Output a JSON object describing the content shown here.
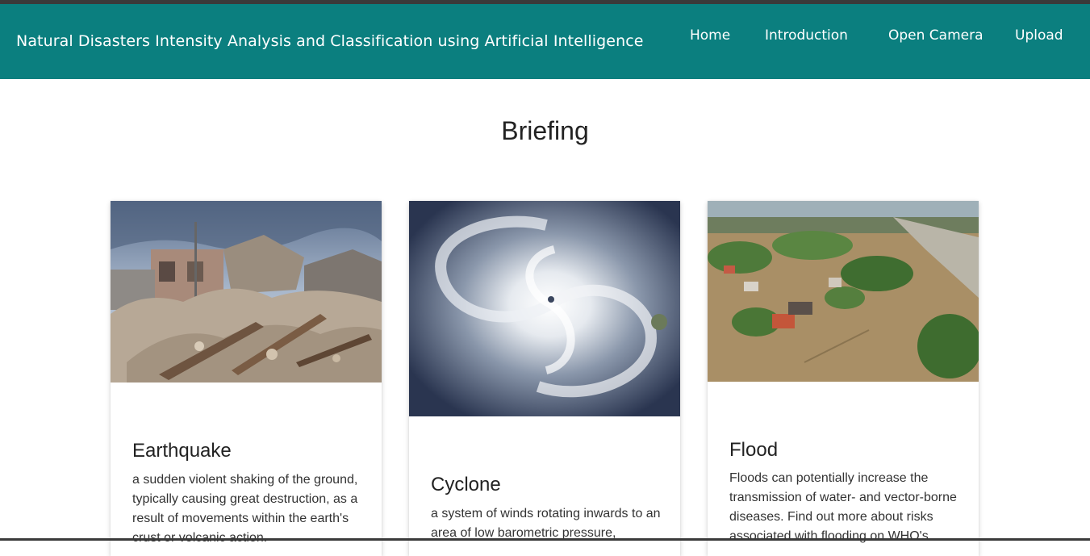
{
  "header": {
    "brand": "Natural Disasters Intensity Analysis and Classification using Artificial Intelligence",
    "nav": [
      "Home",
      "Introduction",
      "Open Camera",
      "Upload"
    ]
  },
  "main": {
    "title": "Briefing",
    "cards": [
      {
        "title": "Earthquake",
        "text": "a sudden violent shaking of the ground, typically causing great destruction, as a result of movements within the earth's crust or volcanic action."
      },
      {
        "title": "Cyclone",
        "text": "a system of winds rotating inwards to an area of low barometric pressure,"
      },
      {
        "title": "Flood",
        "text": "Floods can potentially increase the transmission of water- and vector-borne diseases. Find out more about risks associated with flooding on WHO's"
      }
    ]
  },
  "colors": {
    "navbar": "#0b7f7f",
    "nav_text": "#ffffff"
  }
}
